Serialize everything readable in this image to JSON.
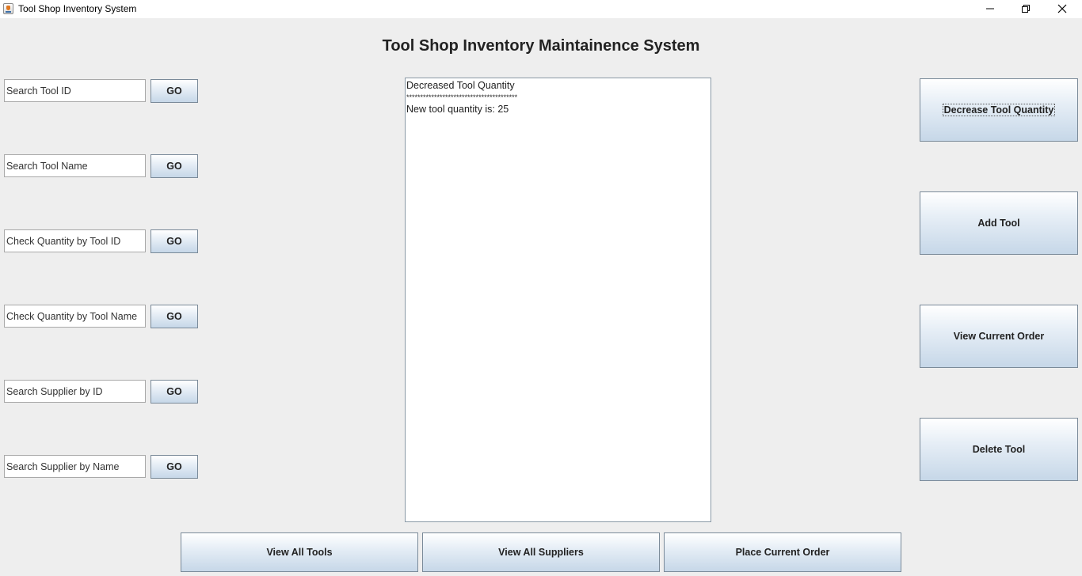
{
  "window": {
    "title": "Tool Shop Inventory System",
    "icon": "java-cup-icon",
    "controls": [
      "minimize-icon",
      "restore-icon",
      "close-icon"
    ]
  },
  "heading": "Tool Shop Inventory Maintainence System",
  "search_fields": [
    {
      "placeholder": "Search Tool ID",
      "button": "GO"
    },
    {
      "placeholder": "Search Tool Name",
      "button": "GO"
    },
    {
      "placeholder": "Check Quantity by Tool ID",
      "button": "GO"
    },
    {
      "placeholder": "Check Quantity by Tool Name",
      "button": "GO"
    },
    {
      "placeholder": "Search Supplier by ID",
      "button": "GO"
    },
    {
      "placeholder": "Search Supplier by Name",
      "button": "GO"
    }
  ],
  "output": {
    "lines": [
      "Decreased Tool Quantity",
      "****************************************",
      "New tool quantity is: 25"
    ]
  },
  "side_buttons": [
    "Decrease Tool Quantity",
    "Add Tool",
    "View Current Order",
    "Delete Tool"
  ],
  "bottom_buttons": [
    "View All Tools",
    "View All Suppliers",
    "Place Current Order"
  ]
}
